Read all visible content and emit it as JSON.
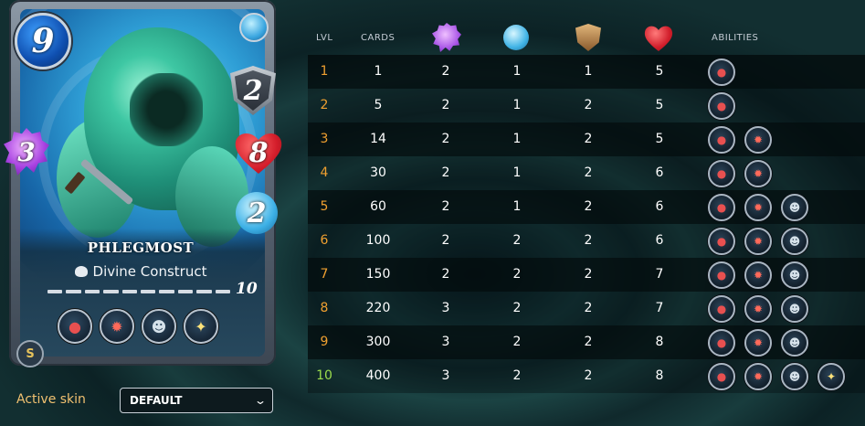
{
  "card": {
    "name": "PHLEGMOST",
    "type": "Divine Construct",
    "mana": "9",
    "magic": "3",
    "armor": "2",
    "health": "8",
    "speed": "2",
    "level": "10",
    "abilities": [
      "mouth-ability-icon",
      "flame-ability-icon",
      "skull-ability-icon",
      "star-ability-icon"
    ]
  },
  "skin": {
    "label": "Active skin",
    "value": "DEFAULT"
  },
  "table": {
    "headers": {
      "lvl": "LVL",
      "cards": "CARDS",
      "magic_icon": "magic-icon",
      "speed_icon": "speed-icon",
      "armor_icon": "armor-icon",
      "health_icon": "health-icon",
      "abilities": "ABILITIES"
    },
    "rows": [
      {
        "lvl": "1",
        "cards": "1",
        "magic": "2",
        "speed": "1",
        "armor": "1",
        "health": "5",
        "abilities": [
          "mouth"
        ]
      },
      {
        "lvl": "2",
        "cards": "5",
        "magic": "2",
        "speed": "1",
        "armor": "2",
        "health": "5",
        "abilities": [
          "mouth"
        ]
      },
      {
        "lvl": "3",
        "cards": "14",
        "magic": "2",
        "speed": "1",
        "armor": "2",
        "health": "5",
        "abilities": [
          "mouth",
          "flame"
        ]
      },
      {
        "lvl": "4",
        "cards": "30",
        "magic": "2",
        "speed": "1",
        "armor": "2",
        "health": "6",
        "abilities": [
          "mouth",
          "flame"
        ]
      },
      {
        "lvl": "5",
        "cards": "60",
        "magic": "2",
        "speed": "1",
        "armor": "2",
        "health": "6",
        "abilities": [
          "mouth",
          "flame",
          "skull"
        ]
      },
      {
        "lvl": "6",
        "cards": "100",
        "magic": "2",
        "speed": "2",
        "armor": "2",
        "health": "6",
        "abilities": [
          "mouth",
          "flame",
          "skull"
        ]
      },
      {
        "lvl": "7",
        "cards": "150",
        "magic": "2",
        "speed": "2",
        "armor": "2",
        "health": "7",
        "abilities": [
          "mouth",
          "flame",
          "skull"
        ]
      },
      {
        "lvl": "8",
        "cards": "220",
        "magic": "3",
        "speed": "2",
        "armor": "2",
        "health": "7",
        "abilities": [
          "mouth",
          "flame",
          "skull"
        ]
      },
      {
        "lvl": "9",
        "cards": "300",
        "magic": "3",
        "speed": "2",
        "armor": "2",
        "health": "8",
        "abilities": [
          "mouth",
          "flame",
          "skull"
        ]
      },
      {
        "lvl": "10",
        "cards": "400",
        "magic": "3",
        "speed": "2",
        "armor": "2",
        "health": "8",
        "abilities": [
          "mouth",
          "flame",
          "skull",
          "star"
        ]
      }
    ]
  },
  "colors": {
    "level_orange": "#f0a030",
    "level_max_green": "#9cdc4c",
    "skin_label": "#f0c070"
  }
}
